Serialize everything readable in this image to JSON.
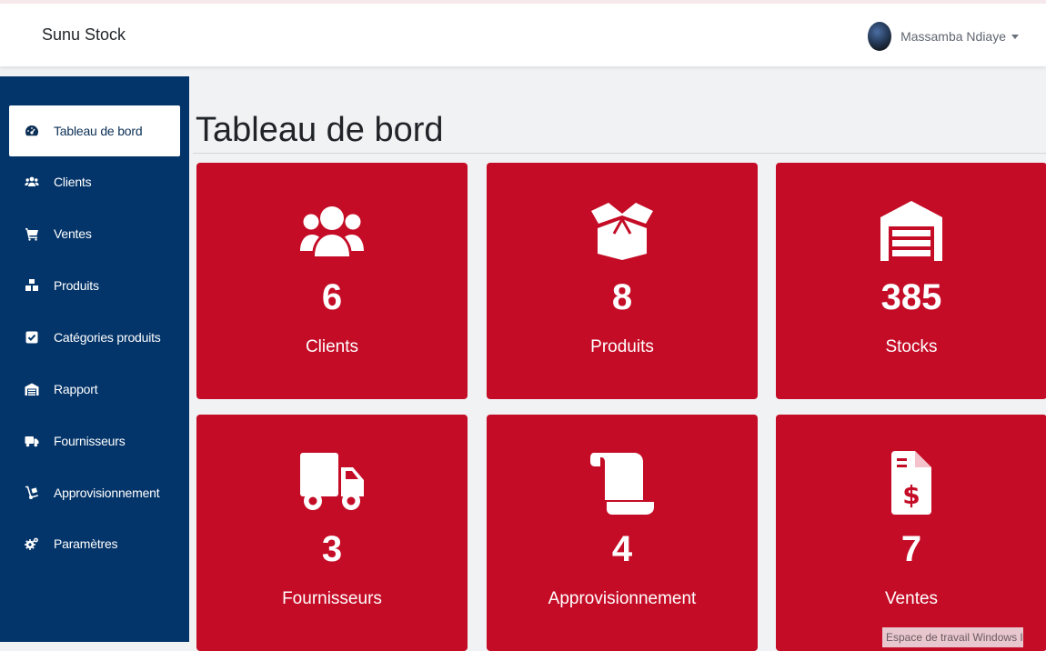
{
  "navbar": {
    "brand": "Sunu Stock",
    "user_name": "Massamba Ndiaye"
  },
  "sidebar": {
    "items": [
      {
        "label": "Tableau de bord",
        "icon": "dashboard-icon",
        "active": true
      },
      {
        "label": "Clients",
        "icon": "users-icon"
      },
      {
        "label": "Ventes",
        "icon": "cart-icon"
      },
      {
        "label": "Produits",
        "icon": "boxes-icon"
      },
      {
        "label": "Catégories produits",
        "icon": "check-square-icon"
      },
      {
        "label": "Rapport",
        "icon": "warehouse-icon"
      },
      {
        "label": "Fournisseurs",
        "icon": "truck-icon"
      },
      {
        "label": "Approvisionnement",
        "icon": "dolly-icon"
      },
      {
        "label": "Paramètres",
        "icon": "cogs-icon"
      }
    ]
  },
  "main": {
    "title": "Tableau de bord",
    "cards": [
      {
        "value": "6",
        "label": "Clients",
        "icon": "users-icon"
      },
      {
        "value": "8",
        "label": "Produits",
        "icon": "open-box-icon"
      },
      {
        "value": "385",
        "label": "Stocks",
        "icon": "warehouse-icon"
      },
      {
        "value": "3",
        "label": "Fournisseurs",
        "icon": "truck-icon"
      },
      {
        "value": "4",
        "label": "Approvisionnement",
        "icon": "scroll-icon"
      },
      {
        "value": "7",
        "label": "Ventes",
        "icon": "invoice-dollar-icon"
      }
    ]
  },
  "overlay": {
    "tooltip": "Espace de travail Windows Ink"
  },
  "colors": {
    "sidebar": "#04356a",
    "card": "#c40c26",
    "page_bg": "#f1f2f4"
  }
}
